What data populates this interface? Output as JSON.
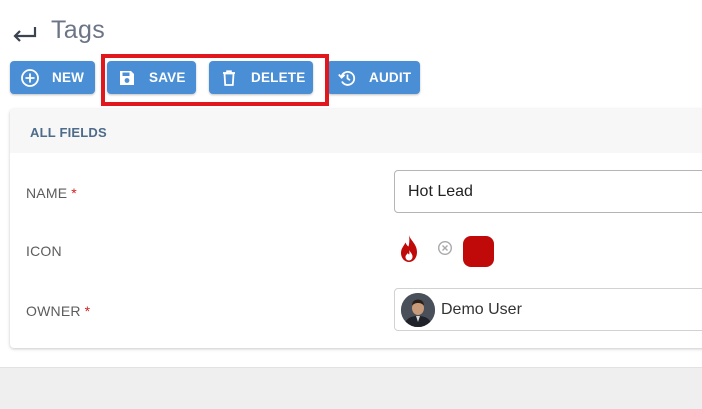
{
  "page": {
    "title": "Tags"
  },
  "toolbar": {
    "new_label": "NEW",
    "save_label": "SAVE",
    "delete_label": "DELETE",
    "audit_label": "AUDIT"
  },
  "card": {
    "header": "ALL FIELDS",
    "fields": {
      "name": {
        "label": "NAME",
        "required_mark": "*",
        "value": "Hot Lead"
      },
      "icon": {
        "label": "ICON",
        "icon": "flame-icon",
        "color": "#c00a0a"
      },
      "owner": {
        "label": "OWNER",
        "required_mark": "*",
        "value": "Demo User"
      }
    }
  },
  "colors": {
    "button": "#4a8fd6",
    "highlight": "#e0171d",
    "header_text": "#4d6b8a",
    "required": "#d42020"
  }
}
